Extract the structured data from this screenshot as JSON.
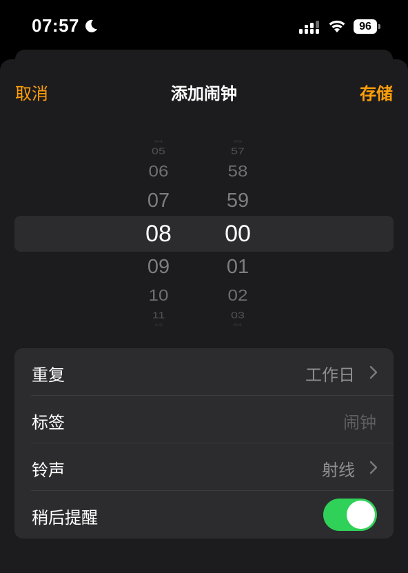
{
  "status_bar": {
    "time": "07:57",
    "battery": "96",
    "icons": [
      "moon-icon",
      "cellular-signal-icon",
      "wifi-icon",
      "battery-icon"
    ]
  },
  "nav": {
    "cancel_label": "取消",
    "title": "添加闹钟",
    "save_label": "存储"
  },
  "picker": {
    "hours": [
      "04",
      "05",
      "06",
      "07",
      "08",
      "09",
      "10",
      "11",
      "12"
    ],
    "minutes": [
      "56",
      "57",
      "58",
      "59",
      "00",
      "01",
      "02",
      "03",
      "04"
    ],
    "selected_hour": "08",
    "selected_minute": "00"
  },
  "settings": {
    "repeat": {
      "label": "重复",
      "value": "工作日"
    },
    "label": {
      "label": "标签",
      "placeholder": "闹钟"
    },
    "sound": {
      "label": "铃声",
      "value": "射线"
    },
    "snooze": {
      "label": "稍后提醒",
      "enabled": true
    }
  },
  "colors": {
    "accent": "#ff9f0a",
    "toggle_on": "#30d158",
    "sheet_bg": "#1c1c1e",
    "group_bg": "#2c2c2e"
  }
}
